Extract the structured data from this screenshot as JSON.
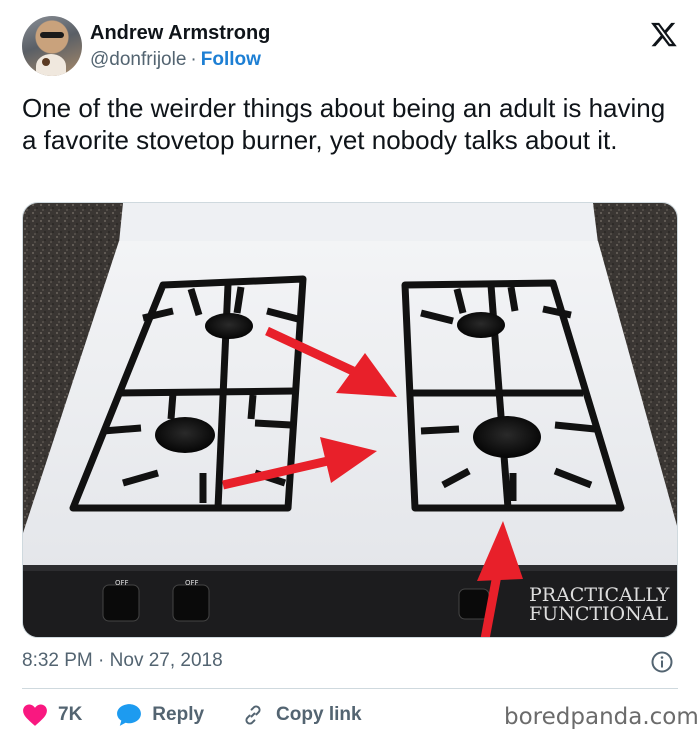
{
  "author": {
    "name": "Andrew Armstrong",
    "handle": "@donfrijole",
    "separator": "·",
    "follow_label": "Follow"
  },
  "tweet": {
    "text": "One of the weirder things about being an adult is having a favorite stovetop burner, yet nobody talks about it."
  },
  "photo": {
    "watermark_line1": "PRACTICALLY",
    "watermark_line2": "FUNCTIONAL",
    "knob_labels": [
      "OFF",
      "OFF"
    ],
    "accent_color": "#e8202a"
  },
  "meta": {
    "time": "8:32 PM",
    "separator": "·",
    "date": "Nov 27, 2018"
  },
  "actions": {
    "likes": "7K",
    "reply_label": "Reply",
    "copy_label": "Copy link"
  },
  "colors": {
    "link": "#1d7fd4",
    "heart": "#f91880",
    "reply_bubble": "#1d9bf0",
    "muted": "#536471"
  },
  "icons": {
    "brand": "x-logo-icon",
    "info": "info-icon",
    "like": "heart-icon",
    "reply": "speech-bubble-icon",
    "copy": "link-icon"
  },
  "footer": {
    "site": "boredpanda.com"
  }
}
